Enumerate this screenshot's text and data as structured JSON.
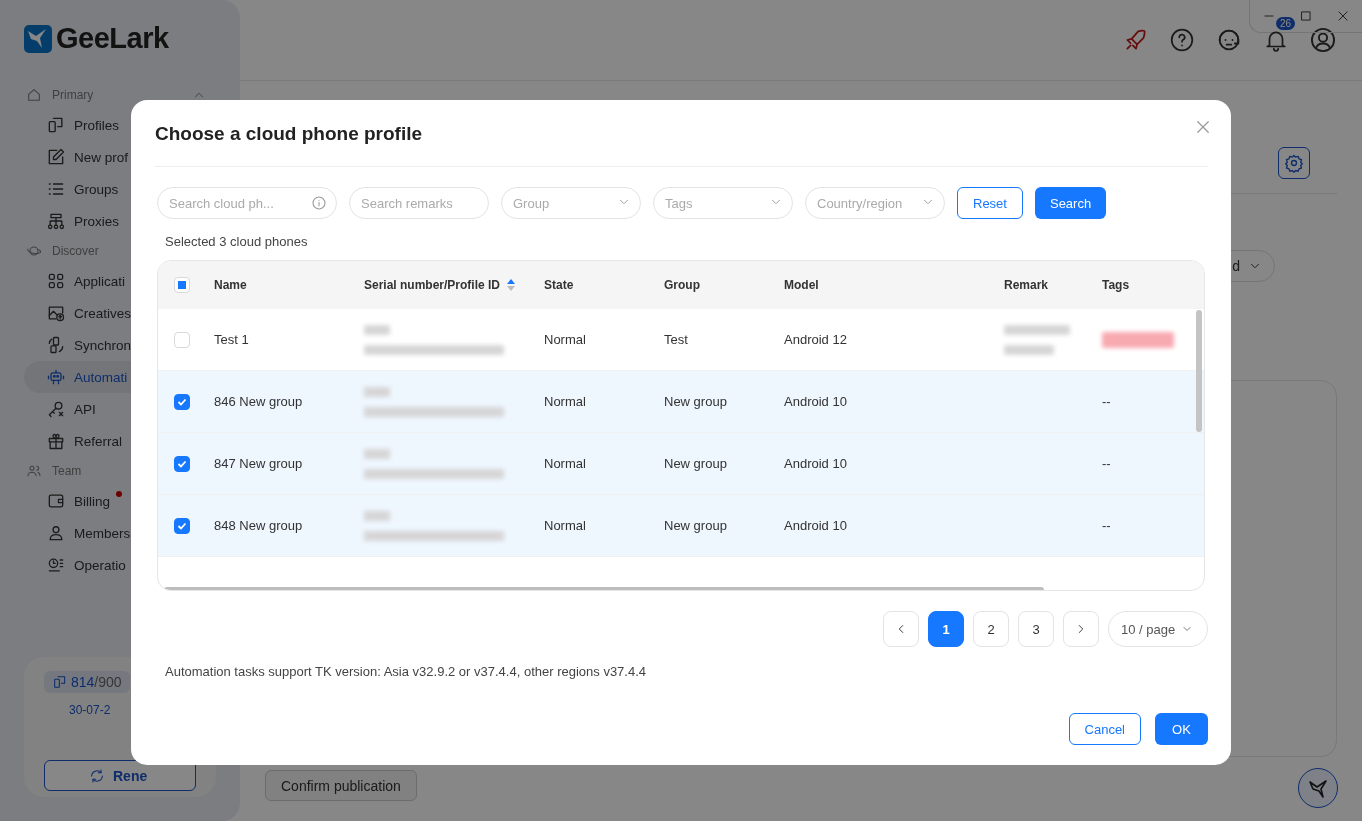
{
  "app": {
    "logo": "GeeLark",
    "notification_count": "26"
  },
  "sidebar": {
    "sections": [
      {
        "label": "Primary",
        "expanded": true,
        "items": [
          {
            "label": "Profiles",
            "selected": false,
            "alert": false
          },
          {
            "label": "New prof",
            "selected": false,
            "alert": false
          },
          {
            "label": "Groups",
            "selected": false,
            "alert": false
          },
          {
            "label": "Proxies",
            "selected": false,
            "alert": false
          }
        ]
      },
      {
        "label": "Discover",
        "items": [
          {
            "label": "Applicati",
            "selected": false,
            "alert": false
          },
          {
            "label": "Creatives",
            "selected": false,
            "alert": false
          },
          {
            "label": "Synchron",
            "selected": false,
            "alert": false
          },
          {
            "label": "Automati",
            "selected": true,
            "alert": false
          },
          {
            "label": "API",
            "selected": false,
            "alert": false
          },
          {
            "label": "Referral",
            "selected": false,
            "alert": false
          }
        ]
      },
      {
        "label": "Team",
        "items": [
          {
            "label": "Billing",
            "selected": false,
            "alert": true
          },
          {
            "label": "Members",
            "selected": false,
            "alert": false
          },
          {
            "label": "Operatio",
            "selected": false,
            "alert": false
          }
        ]
      }
    ],
    "plan": {
      "usage": "814",
      "limit": "/900",
      "date": "30-07-2",
      "renew": "Rene"
    }
  },
  "main": {
    "dropdown_value": "d",
    "confirm_button": "Confirm publication"
  },
  "dialog": {
    "title": "Choose a cloud phone profile",
    "filters": [
      {
        "kind": "search",
        "placeholder": "Search cloud ph..."
      },
      {
        "kind": "text",
        "placeholder": "Search remarks"
      },
      {
        "kind": "select",
        "placeholder": "Group"
      },
      {
        "kind": "select",
        "placeholder": "Tags"
      },
      {
        "kind": "select",
        "placeholder": "Country/region"
      }
    ],
    "reset_button": "Reset",
    "search_button": "Search",
    "selection_summary": "Selected 3 cloud phones",
    "table": {
      "select_all_partial": true,
      "columns": [
        {
          "label": "Name"
        },
        {
          "label": "Serial number/Profile ID",
          "sorted_ascending": true
        },
        {
          "label": "State"
        },
        {
          "label": "Group"
        },
        {
          "label": "Model"
        },
        {
          "label": "Remark"
        },
        {
          "label": "Tags"
        }
      ],
      "rows": [
        {
          "checked": false,
          "name": "Test 1",
          "state": "Normal",
          "group": "Test",
          "model": "Android 12",
          "remark_blurred": true,
          "tags_blurred": true
        },
        {
          "checked": true,
          "name": "846 New group",
          "state": "Normal",
          "group": "New group",
          "model": "Android 10",
          "remark_blurred": false,
          "tags_blurred": false,
          "tags": "--"
        },
        {
          "checked": true,
          "name": "847 New group",
          "state": "Normal",
          "group": "New group",
          "model": "Android 10",
          "remark_blurred": false,
          "tags_blurred": false,
          "tags": "--"
        },
        {
          "checked": true,
          "name": "848 New group",
          "state": "Normal",
          "group": "New group",
          "model": "Android 10",
          "remark_blurred": false,
          "tags_blurred": false,
          "tags": "--"
        }
      ]
    },
    "pagination": {
      "pages": [
        {
          "label": "1",
          "selected": true
        },
        {
          "label": "2",
          "selected": false
        },
        {
          "label": "3",
          "selected": false
        }
      ],
      "page_size": "10 / page"
    },
    "note": "Automation tasks support TK version: Asia v32.9.2 or v37.4.4, other regions v37.4.4",
    "cancel_button": "Cancel",
    "ok_button": "OK"
  }
}
